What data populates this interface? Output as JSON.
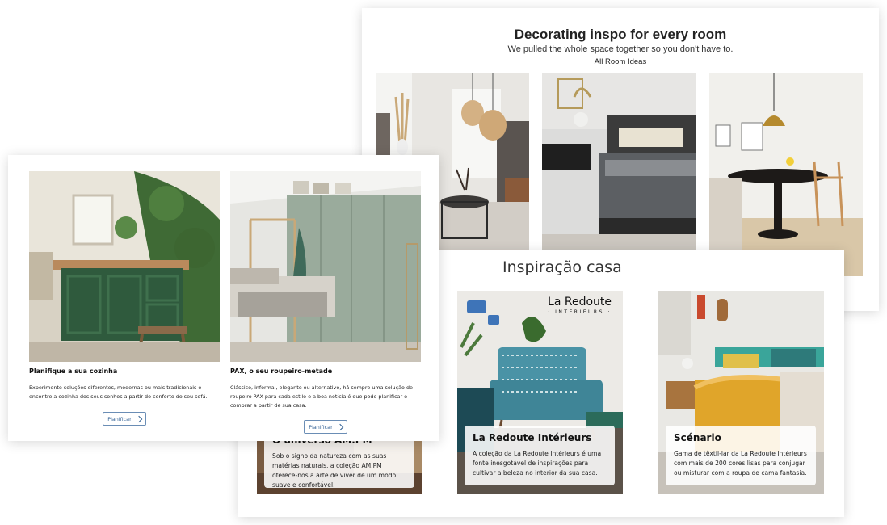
{
  "room_ideas": {
    "title": "Decorating inspo for every room",
    "subtitle": "We pulled the whole space together so you don't have to.",
    "link": "All Room Ideas"
  },
  "inspiration": {
    "title": "Inspiração casa",
    "cards": [
      {
        "title": "O universo AM.PM",
        "text": "Sob o signo da natureza com as suas matérias naturais, a coleção AM.PM oferece-nos a arte de viver de um modo suave e confortável."
      },
      {
        "title": "La Redoute Intérieurs",
        "text": "A coleção da La Redoute Intérieurs é uma fonte inesgotável de inspirações para cultivar a beleza no interior da sua casa."
      },
      {
        "title": "Scénario",
        "text": "Gama de têxtil-lar da La Redoute Intérieurs com mais de 200 cores lisas para conjugar ou misturar com a roupa de cama fantasia."
      }
    ],
    "logo": {
      "line1": "La Redoute",
      "line2": "· INTERIEURS ·"
    }
  },
  "planner": {
    "items": [
      {
        "title": "Planifique a sua cozinha",
        "text": "Experimente soluções diferentes, modernas ou mais tradicionais e encontre a cozinha dos seus sonhos a partir do conforto do seu sofá.",
        "button": "Planificar"
      },
      {
        "title": "PAX, o seu roupeiro-metade",
        "text": "Clássico, informal, elegante ou alternativo, há sempre uma solução de roupeiro PAX para cada estilo e a boa notícia é que pode planificar e comprar a partir de sua casa.",
        "button": "Planificar"
      }
    ]
  },
  "colors": {
    "kitchen_green": "#2f5a3d",
    "wardrobe_sage": "#9aab9c",
    "button_blue": "#2f5f94",
    "mustard": "#e0a52a",
    "teal": "#2e8a8a"
  }
}
